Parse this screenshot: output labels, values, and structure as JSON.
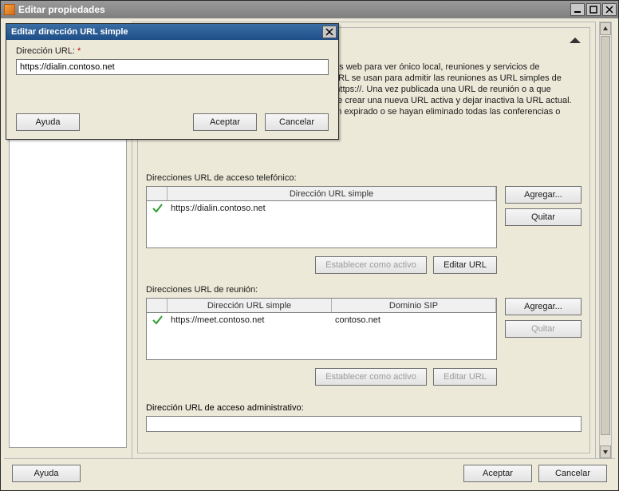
{
  "outer": {
    "title": "Editar propiedades",
    "help_label": "Ayuda",
    "accept_label": "Aceptar",
    "cancel_label": "Cancelar"
  },
  "modal": {
    "title": "Editar dirección URL simple",
    "field_label": "Dirección URL:",
    "required_mark": "*",
    "url_value": "https://dialin.contoso.net",
    "help_label": "Ayuda",
    "accept_label": "Aceptar",
    "cancel_label": "Cancelar"
  },
  "main": {
    "description": "y estos las usarán para tener acceso a las páginas web para ver ónico local, reuniones y servicios de administración. La URL s reuniones; las demás URL se usan para admitir las reuniones as URL simples de reunión y de acceso telefónico son que incluyan https://. Una vez publicada una URL de reunión o a que impediría a los usuarios unirse a reuniones o debe crear una nueva URL activa y dejar inactiva la URL actual. Las URL inactivas se pueden quitar cuando hayan expirado o se hayan eliminado todas las conferencias o reuniones que usen dicha URL.",
    "dialin": {
      "section_label": "Direcciones URL de acceso telefónico:",
      "col1_header": "Dirección URL simple",
      "rows": [
        {
          "url": "https://dialin.contoso.net",
          "active": true
        }
      ],
      "add_label": "Agregar...",
      "remove_label": "Quitar",
      "set_active_label": "Establecer como activo",
      "edit_label": "Editar URL"
    },
    "meet": {
      "section_label": "Direcciones URL de reunión:",
      "col1_header": "Dirección URL simple",
      "col2_header": "Dominio SIP",
      "rows": [
        {
          "url": "https://meet.contoso.net",
          "sip": "contoso.net",
          "active": true
        }
      ],
      "add_label": "Agregar...",
      "remove_label": "Quitar",
      "set_active_label": "Establecer como activo",
      "edit_label": "Editar URL"
    },
    "admin": {
      "label": "Dirección URL de acceso administrativo:",
      "value": ""
    }
  }
}
